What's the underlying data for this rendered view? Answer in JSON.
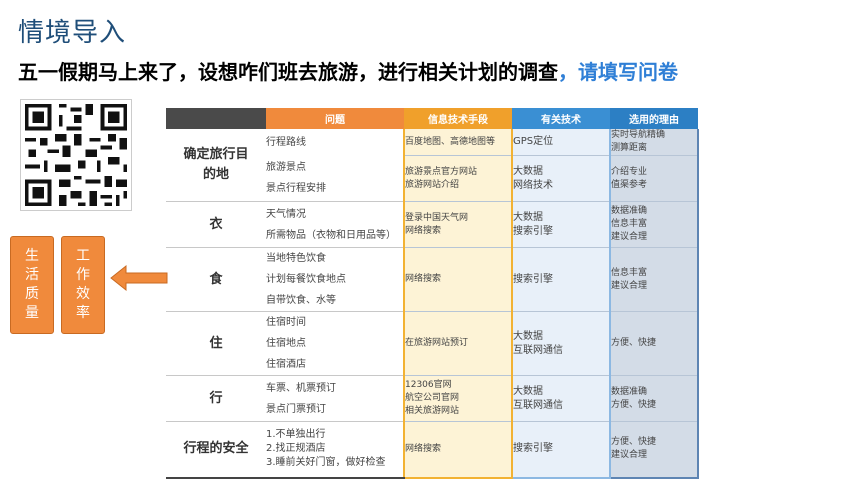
{
  "title": "情境导入",
  "subtitle": "五一假期马上来了，设想咋们班去旅游，进行相关计划的调查",
  "subtitle_highlight": "，请填写问卷",
  "tags": [
    "生活质量",
    "工作效率"
  ],
  "table": {
    "headers": [
      "",
      "问题",
      "信息技术手段",
      "有关技术",
      "选用的理由"
    ],
    "rows": [
      {
        "category": "确定旅行目的地",
        "questions": [
          "行程路线",
          "旅游景点",
          "景点行程安排"
        ],
        "it_means": [
          [
            "百度地图、高德地图等"
          ],
          [
            "旅游景点官方网站",
            "旅游网站介绍"
          ]
        ],
        "tech": [
          [
            "GPS定位"
          ],
          [
            "大数据",
            "网络技术"
          ]
        ],
        "reasons": [
          [
            "实时导航精确",
            "测算距离"
          ],
          [
            "介绍专业",
            "值渠参考"
          ]
        ]
      },
      {
        "category": "衣",
        "questions": [
          "天气情况",
          "所需物品（衣物和日用品等）"
        ],
        "it_means": [
          "登录中国天气网",
          "网络搜索"
        ],
        "tech": [
          "大数据",
          "搜索引擎"
        ],
        "reasons": [
          "数据准确",
          "信息丰富",
          "建议合理"
        ]
      },
      {
        "category": "食",
        "questions": [
          "当地特色饮食",
          "计划每餐饮食地点",
          "自带饮食、水等"
        ],
        "it_means": [
          "网络搜索"
        ],
        "tech": [
          "搜索引擎"
        ],
        "reasons": [
          "信息丰富",
          "建议合理"
        ]
      },
      {
        "category": "住",
        "questions": [
          "住宿时间",
          "住宿地点",
          "住宿酒店"
        ],
        "it_means": [
          "在旅游网站预订"
        ],
        "tech": [
          "大数据",
          "互联网通信"
        ],
        "reasons": [
          "方便、快捷"
        ]
      },
      {
        "category": "行",
        "questions": [
          "车票、机票预订",
          "景点门票预订"
        ],
        "it_means": [
          "12306官网",
          "航空公司官网",
          "相关旅游网站"
        ],
        "tech": [
          "大数据",
          "互联网通信"
        ],
        "reasons": [
          "数据准确",
          "方便、快捷"
        ]
      },
      {
        "category": "行程的安全",
        "questions": [
          "1.不单独出行",
          "2.找正规酒店",
          "3.睡前关好门窗，做好检查"
        ],
        "it_means": [
          "网络搜索"
        ],
        "tech": [
          "搜索引擎"
        ],
        "reasons": [
          "方便、快捷",
          "建议合理"
        ]
      }
    ]
  },
  "colors": {
    "title": "#1f4e79",
    "highlight": "#2f7fd6",
    "orange": "#f08a3c",
    "it_fill": "#fdf3d6",
    "tech_fill": "#e8f0f9",
    "reason_fill": "#d3dce7"
  },
  "icons": [
    "qr-code-icon",
    "arrow-left-icon"
  ]
}
